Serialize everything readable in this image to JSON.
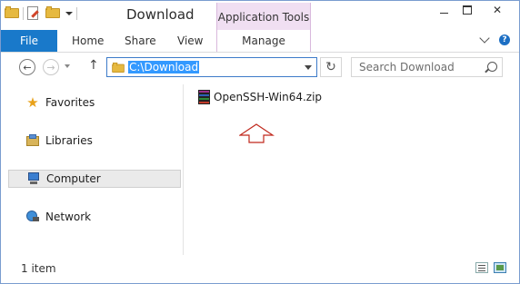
{
  "window": {
    "title": "Download",
    "context_tab_group": "Application Tools"
  },
  "ribbon": {
    "tabs": {
      "file": "File",
      "home": "Home",
      "share": "Share",
      "view": "View",
      "manage": "Manage"
    }
  },
  "window_controls": {
    "close_glyph": "✕"
  },
  "navigation": {
    "back_glyph": "←",
    "forward_glyph": "→",
    "up_glyph": "↑",
    "refresh_glyph": "↻",
    "address": "C:\\Download",
    "search_placeholder": "Search Download"
  },
  "nav_pane": {
    "items": [
      {
        "label": "Favorites",
        "icon": "star-icon"
      },
      {
        "label": "Libraries",
        "icon": "libraries-icon"
      },
      {
        "label": "Computer",
        "icon": "computer-icon",
        "selected": true
      },
      {
        "label": "Network",
        "icon": "network-icon"
      }
    ]
  },
  "files": [
    {
      "name": "OpenSSH-Win64.zip",
      "icon": "zip-archive-icon"
    }
  ],
  "annotation": {
    "arrow_color": "#c0281c"
  },
  "status_bar": {
    "item_count": "1 item"
  }
}
